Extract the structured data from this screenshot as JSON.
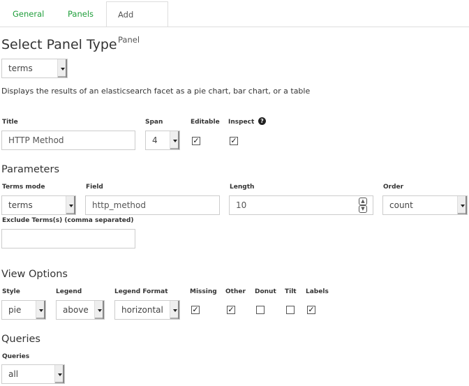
{
  "tabs": [
    {
      "label": "General"
    },
    {
      "label": "Panels"
    },
    {
      "label": "Add Panel",
      "active": true
    }
  ],
  "heading": "Select Panel Type",
  "panel_type": "terms",
  "description": "Displays the results of an elasticsearch facet as a pie chart, bar chart, or a table",
  "general": {
    "title_label": "Title",
    "title_value": "HTTP Method",
    "span_label": "Span",
    "span_value": "4",
    "editable_label": "Editable",
    "editable": true,
    "inspect_label": "Inspect",
    "inspect": true,
    "help_icon": "question-circle-icon"
  },
  "parameters": {
    "heading": "Parameters",
    "terms_mode_label": "Terms mode",
    "terms_mode": "terms",
    "field_label": "Field",
    "field": "http_method",
    "length_label": "Length",
    "length": "10",
    "order_label": "Order",
    "order": "count",
    "exclude_label": "Exclude Terms(s) (comma separated)",
    "exclude": ""
  },
  "view": {
    "heading": "View Options",
    "style_label": "Style",
    "style": "pie",
    "legend_label": "Legend",
    "legend": "above",
    "legend_format_label": "Legend Format",
    "legend_format": "horizontal",
    "checks": [
      {
        "label": "Missing",
        "checked": true
      },
      {
        "label": "Other",
        "checked": true
      },
      {
        "label": "Donut",
        "checked": false
      },
      {
        "label": "Tilt",
        "checked": false
      },
      {
        "label": "Labels",
        "checked": true
      }
    ]
  },
  "queries": {
    "heading": "Queries",
    "label": "Queries",
    "value": "all"
  }
}
